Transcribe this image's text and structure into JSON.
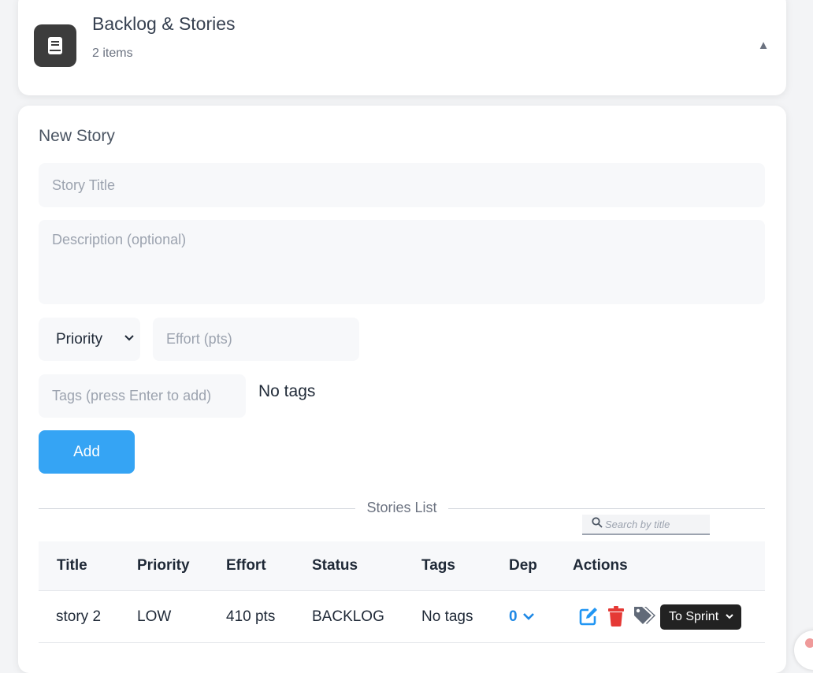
{
  "header": {
    "title": "Backlog & Stories",
    "count": "2 items",
    "collapse_glyph": "▲",
    "icon": "book-icon"
  },
  "form": {
    "section_title": "New Story",
    "title_placeholder": "Story Title",
    "description_placeholder": "Description (optional)",
    "priority_label": "Priority",
    "effort_placeholder": "Effort (pts)",
    "tags_placeholder": "Tags (press Enter to add)",
    "no_tags": "No tags",
    "add_label": "Add"
  },
  "list": {
    "divider_label": "Stories List",
    "search_placeholder": "Search by title",
    "columns": [
      "Title",
      "Priority",
      "Effort",
      "Status",
      "Tags",
      "Dep",
      "Actions"
    ],
    "rows": [
      {
        "title": "story 2",
        "priority": "LOW",
        "effort": "410 pts",
        "status": "BACKLOG",
        "tags": "No tags",
        "dep": "0",
        "sprint_action": "To Sprint"
      }
    ]
  },
  "colors": {
    "accent": "#35a4f4",
    "link": "#1e88e5",
    "danger": "#e53935",
    "badge_dark": "#3c3c3c",
    "tag_icon": "#616a78"
  }
}
